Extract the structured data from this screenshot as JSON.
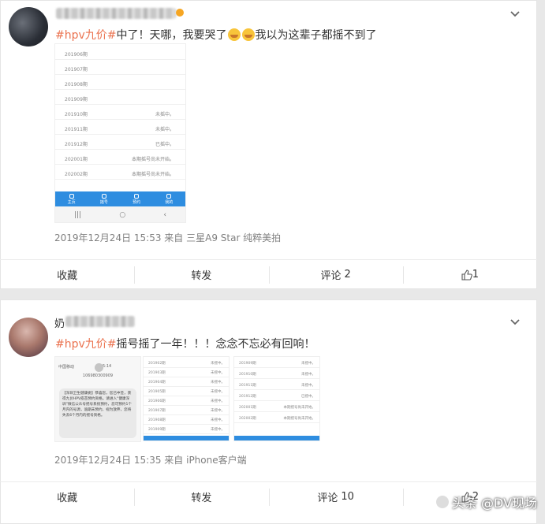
{
  "posts": [
    {
      "text": {
        "tag": "#hpv九价#",
        "body_a": "中了！天哪，我要哭了",
        "body_b": "我以为这辈子都摇不到了"
      },
      "emoji_names": [
        "crying-face",
        "crying-face"
      ],
      "meta": "2019年12月24日 15:53  来自 三星A9 Star 纯粹美拍",
      "actions": {
        "collect": "收藏",
        "repost": "转发",
        "comment": "评论",
        "comment_count": "2",
        "like_count": "1"
      },
      "screenshot": {
        "rows": [
          {
            "period": "201906期",
            "status": ""
          },
          {
            "period": "201907期",
            "status": ""
          },
          {
            "period": "201908期",
            "status": ""
          },
          {
            "period": "201909期",
            "status": ""
          },
          {
            "period": "201910期",
            "status": "未摇中。"
          },
          {
            "period": "201911期",
            "status": "未摇中。"
          },
          {
            "period": "201912期",
            "status": "已摇中。"
          },
          {
            "period": "202001期",
            "status": "本期摇号尚未开始。"
          },
          {
            "period": "202002期",
            "status": "本期摇号尚未开始。"
          }
        ],
        "tabs": [
          "主页",
          "摇号",
          "预约",
          "我的"
        ],
        "nav": [
          "|||",
          "○",
          "‹"
        ]
      }
    },
    {
      "name_first_char": "奶",
      "text": {
        "tag": "#hpv九价#",
        "body": "摇号摇了一年！！！念念不忘必有回响！"
      },
      "meta": "2019年12月24日 15:35  来自 iPhone客户端",
      "actions": {
        "collect": "收藏",
        "repost": "转发",
        "comment": "评论",
        "comment_count": "10",
        "like_count": "2"
      },
      "sms": {
        "carrier": "中国移动",
        "time": "15:14",
        "sender": "106980300909",
        "message": "【深圳卫生健康委】恭喜您，您已中签，获得九价HPV疫苗预约资格。请进入“健康深圳”微信公众号摇号系统预约，您可预约1个月内的号源，逾期未预约，视为放弃，您将失去6个月内的摇号资格。"
      },
      "list_a": {
        "rows": [
          {
            "period": "201902期",
            "status": "未摇中。"
          },
          {
            "period": "201903期",
            "status": "未摇中。"
          },
          {
            "period": "201904期",
            "status": "未摇中。"
          },
          {
            "period": "201905期",
            "status": "未摇中。"
          },
          {
            "period": "201906期",
            "status": "未摇中。"
          },
          {
            "period": "201907期",
            "status": "未摇中。"
          },
          {
            "period": "201908期",
            "status": "未摇中。"
          },
          {
            "period": "201909期",
            "status": "未摇中。"
          }
        ]
      },
      "list_b": {
        "rows": [
          {
            "period": "201909期",
            "status": "未摇中。"
          },
          {
            "period": "201910期",
            "status": "未摇中。"
          },
          {
            "period": "201911期",
            "status": "未摇中。"
          },
          {
            "period": "201912期",
            "status": "已摇中。"
          },
          {
            "period": "202001期",
            "status": "本期摇号尚未开始。"
          },
          {
            "period": "202002期",
            "status": "本期摇号尚未开始。"
          }
        ]
      }
    }
  ],
  "watermark": "头条 @DV现场",
  "colors": {
    "tag": "#eb7350",
    "tabbar": "#2e8de0",
    "badge": "#f6a623"
  }
}
